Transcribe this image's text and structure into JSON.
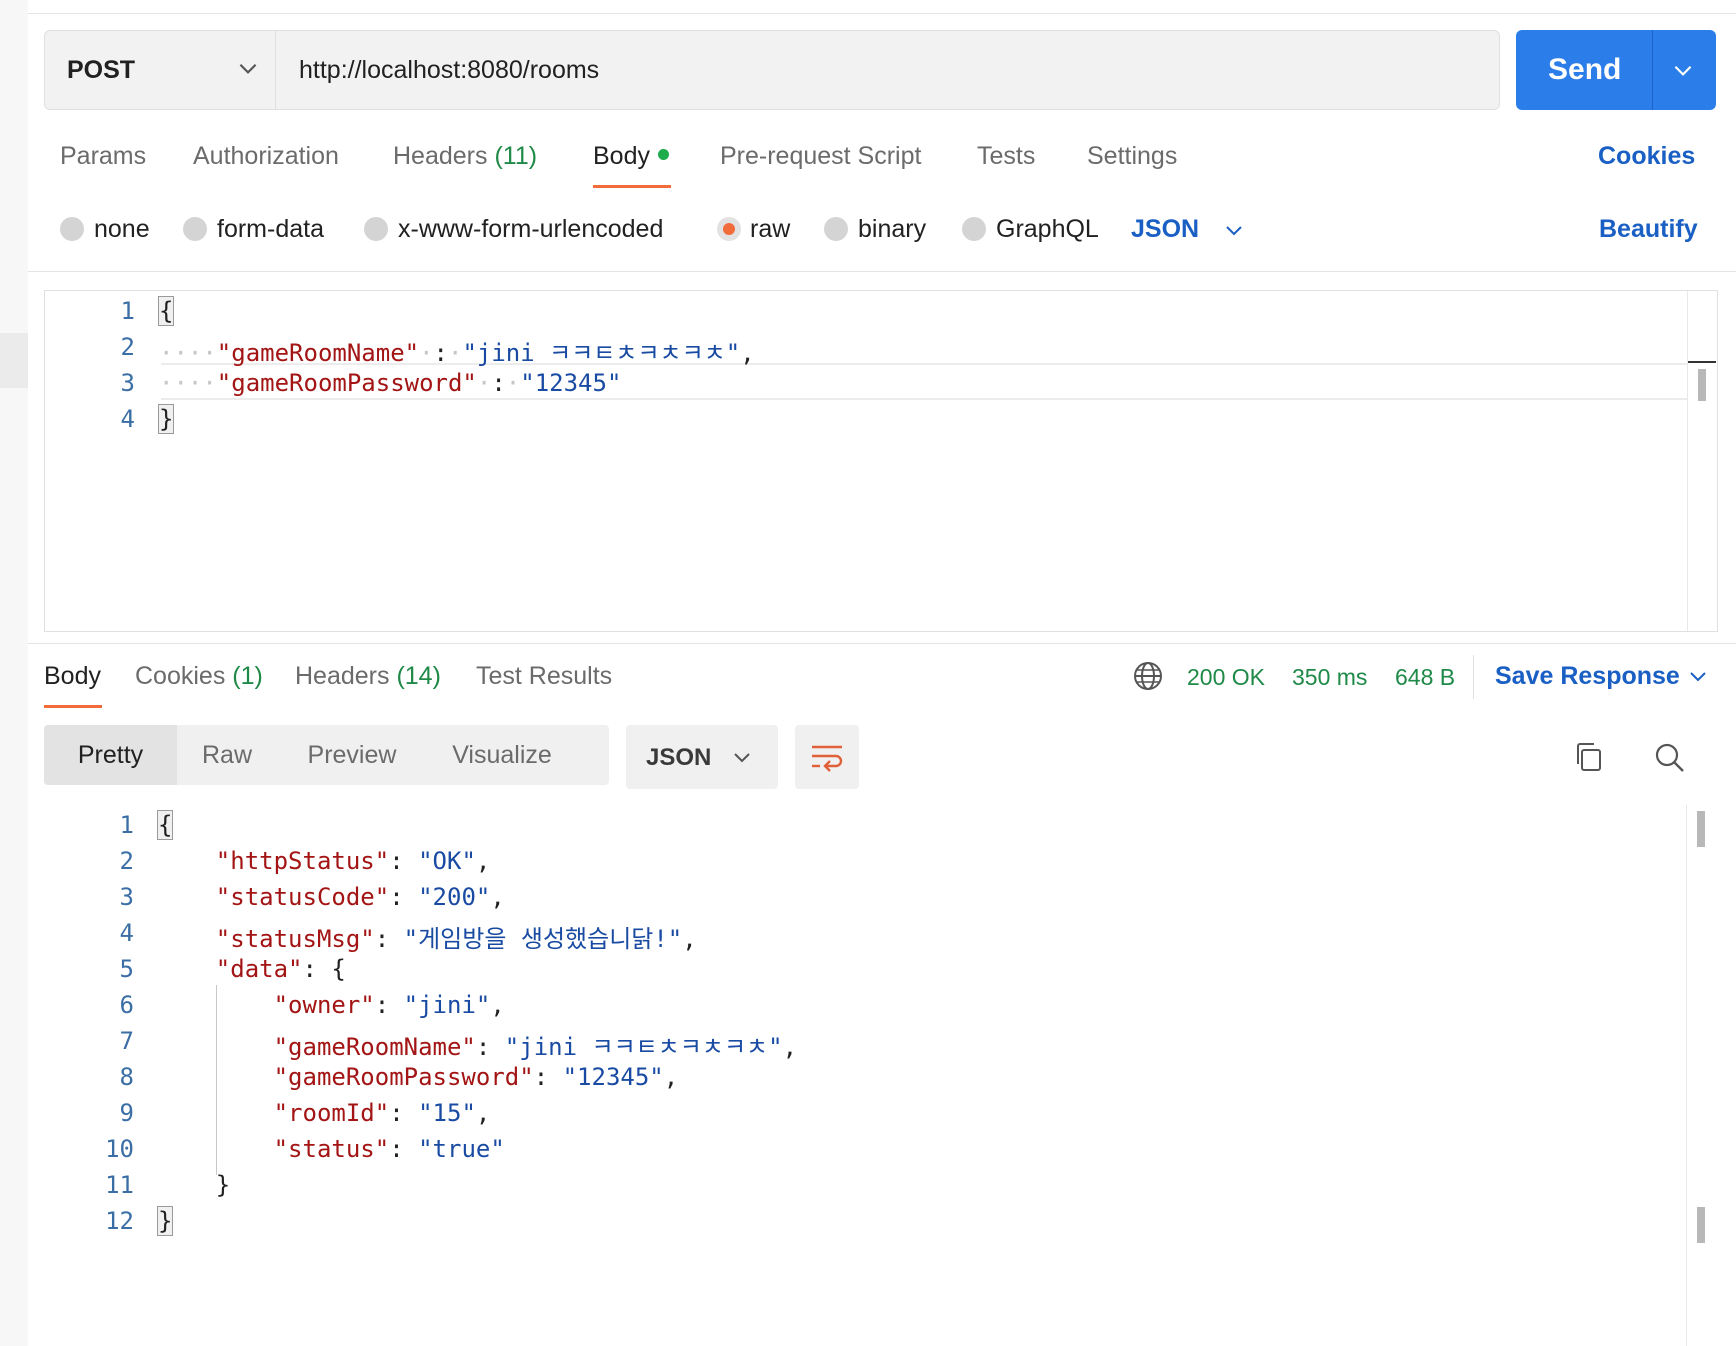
{
  "request": {
    "method": "POST",
    "url": "http://localhost:8080/rooms",
    "send_label": "Send"
  },
  "request_tabs": {
    "params": "Params",
    "authorization": "Authorization",
    "headers": "Headers",
    "headers_count": "(11)",
    "body": "Body",
    "prerequest": "Pre-request Script",
    "tests": "Tests",
    "settings": "Settings",
    "cookies": "Cookies"
  },
  "body_types": {
    "none": "none",
    "form_data": "form-data",
    "urlencoded": "x-www-form-urlencoded",
    "raw": "raw",
    "binary": "binary",
    "graphql": "GraphQL",
    "selected": "raw",
    "language": "JSON",
    "beautify": "Beautify"
  },
  "request_body": {
    "line_numbers": [
      "1",
      "2",
      "3",
      "4"
    ],
    "open_brace": "{",
    "close_brace": "}",
    "key1": "\"gameRoomName\"",
    "val1": "\"jini ㅋㅋㅌㅊㅋㅊㅋㅊ\"",
    "key2": "\"gameRoomPassword\"",
    "val2": "\"12345\""
  },
  "response_tabs": {
    "body": "Body",
    "cookies": "Cookies",
    "cookies_count": "(1)",
    "headers": "Headers",
    "headers_count": "(14)",
    "test_results": "Test Results"
  },
  "response_status": {
    "status": "200 OK",
    "time": "350 ms",
    "size": "648 B",
    "save_label": "Save Response"
  },
  "view_modes": {
    "pretty": "Pretty",
    "raw": "Raw",
    "preview": "Preview",
    "visualize": "Visualize",
    "format": "JSON"
  },
  "response_body": {
    "line_numbers": [
      "1",
      "2",
      "3",
      "4",
      "5",
      "6",
      "7",
      "8",
      "9",
      "10",
      "11",
      "12"
    ],
    "open_brace": "{",
    "close_brace": "}",
    "k_httpStatus": "\"httpStatus\"",
    "v_httpStatus": "\"OK\"",
    "k_statusCode": "\"statusCode\"",
    "v_statusCode": "\"200\"",
    "k_statusMsg": "\"statusMsg\"",
    "v_statusMsg": "\"게임방을 생성했습니닭!\"",
    "k_data": "\"data\"",
    "k_owner": "\"owner\"",
    "v_owner": "\"jini\"",
    "k_gameRoomName": "\"gameRoomName\"",
    "v_gameRoomName": "\"jini ㅋㅋㅌㅊㅋㅊㅋㅊ\"",
    "k_gameRoomPassword": "\"gameRoomPassword\"",
    "v_gameRoomPassword": "\"12345\"",
    "k_roomId": "\"roomId\"",
    "v_roomId": "\"15\"",
    "k_status": "\"status\"",
    "v_status": "\"true\""
  },
  "colors": {
    "accent_orange": "#f26b3a",
    "send_blue": "#2b7de9",
    "link_blue": "#1a5fc4",
    "status_green": "#1f8a48"
  }
}
